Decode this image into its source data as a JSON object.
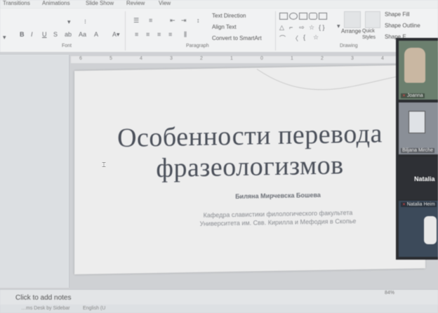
{
  "ribbon": {
    "tabs": [
      "Transitions",
      "Animations",
      "Slide Show",
      "Review",
      "View"
    ],
    "groups": {
      "font": "Font",
      "paragraph": "Paragraph",
      "drawing": "Drawing"
    },
    "buttons": {
      "text_direction": "Text Direction",
      "align_text": "Align Text",
      "convert_smartart": "Convert to SmartArt",
      "arrange": "Arrange",
      "quick_styles": "Quick Styles",
      "shape_fill": "Shape Fill",
      "shape_outline": "Shape Outline",
      "shape_effects": "Shape E"
    }
  },
  "ruler": {
    "ticks": [
      "6",
      "5",
      "4",
      "3",
      "2",
      "1",
      "0",
      "1",
      "2",
      "3",
      "4"
    ]
  },
  "slide": {
    "title_line1": "Особенности перевода",
    "title_line2": "фразеологизмов",
    "author": "Биляна Мирчевска Бошева",
    "affiliation_line1": "Кафедра славистики филологического факультета",
    "affiliation_line2": "Университета им. Свв. Кирилла и Мефодия в Скопье"
  },
  "participants": [
    {
      "name": "Joanna"
    },
    {
      "name": "Biljana Mirche"
    },
    {
      "name": "Natalia"
    },
    {
      "name": "Natalia Heim"
    }
  ],
  "notes": {
    "placeholder": "Click to add notes"
  },
  "status": {
    "left": "…ms Desk by Sidebar",
    "language": "English (U",
    "zoom": "84%"
  },
  "colors": {
    "slide_bg": "#ededed",
    "title_color": "#4a4f59",
    "video_bg": "#2b2d31"
  }
}
